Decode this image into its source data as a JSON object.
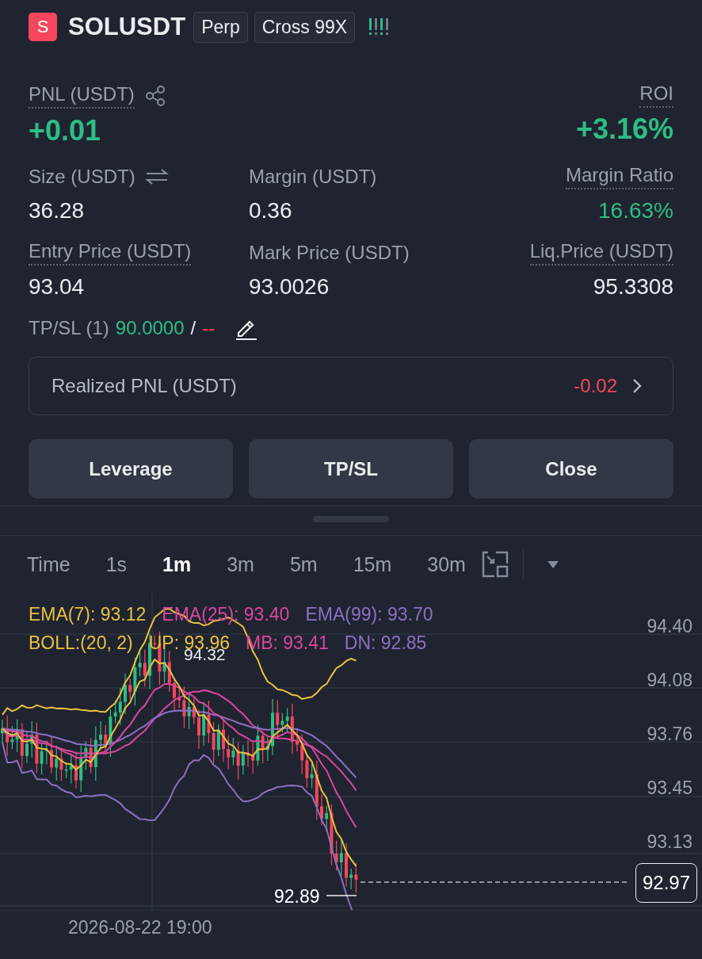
{
  "header": {
    "logo": "S",
    "symbol": "SOLUSDT",
    "badges": [
      "Perp",
      "Cross 99X"
    ]
  },
  "pnl": {
    "label": "PNL (USDT)",
    "value": "+0.01"
  },
  "roi": {
    "label": "ROI",
    "value": "+3.16%"
  },
  "stats": [
    {
      "label": "Size (USDT)",
      "value": "36.28",
      "kind": "swap",
      "underlined": false,
      "positive": false
    },
    {
      "label": "Margin (USDT)",
      "value": "0.36",
      "kind": "plain",
      "underlined": false,
      "positive": false
    },
    {
      "label": "Margin Ratio",
      "value": "16.63%",
      "kind": "plain",
      "underlined": true,
      "positive": true
    },
    {
      "label": "Entry Price (USDT)",
      "value": "93.04",
      "kind": "plain",
      "underlined": true,
      "positive": false
    },
    {
      "label": "Mark Price (USDT)",
      "value": "93.0026",
      "kind": "plain",
      "underlined": false,
      "positive": false
    },
    {
      "label": "Liq.Price (USDT)",
      "value": "95.3308",
      "kind": "plain",
      "underlined": true,
      "positive": false
    }
  ],
  "tpsl": {
    "label": "TP/SL (1)",
    "tp": "90.0000",
    "separator": "/",
    "sl": "--"
  },
  "realized": {
    "label": "Realized PNL (USDT)",
    "value": "-0.02"
  },
  "buttons": [
    "Leverage",
    "TP/SL",
    "Close"
  ],
  "timeframes": [
    {
      "label": "Time",
      "selected": false
    },
    {
      "label": "1s",
      "selected": false
    },
    {
      "label": "1m",
      "selected": true
    },
    {
      "label": "3m",
      "selected": false
    },
    {
      "label": "5m",
      "selected": false
    },
    {
      "label": "15m",
      "selected": false
    },
    {
      "label": "30m",
      "selected": false
    }
  ],
  "indicators": [
    [
      {
        "text": "EMA(7): 93.12",
        "color": "#e9c13f"
      },
      {
        "text": "EMA(25): 93.40",
        "color": "#d9479f"
      },
      {
        "text": "EMA(99): 93.70",
        "color": "#8d6fc4"
      }
    ],
    [
      {
        "text": "BOLL:(20, 2)",
        "color": "#e9c13f"
      },
      {
        "text": "UP: 93.96",
        "color": "#e9c13f"
      },
      {
        "text": "MB: 93.41",
        "color": "#d9479f"
      },
      {
        "text": "DN: 92.85",
        "color": "#8d6fc4"
      }
    ]
  ],
  "price_axis": [
    "94.40",
    "94.08",
    "93.76",
    "93.45",
    "93.13"
  ],
  "high_marker": "94.32",
  "low_marker": "92.89",
  "last_price": "92.97",
  "time_label": "2026-08-22 19:00"
}
